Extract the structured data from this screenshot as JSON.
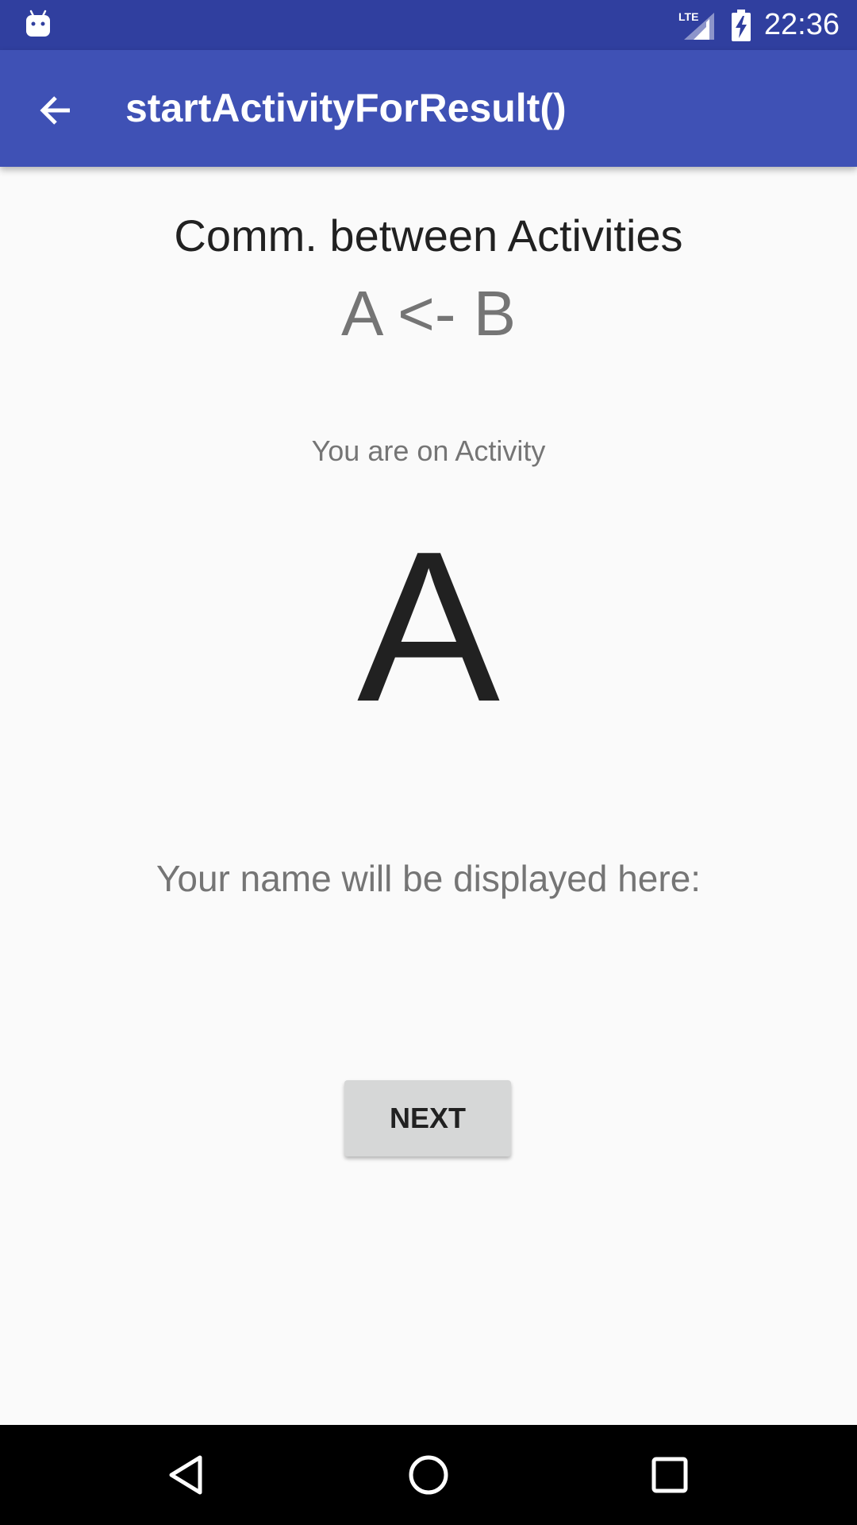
{
  "status_bar": {
    "time": "22:36",
    "network_label": "LTE",
    "icons": [
      "android-icon",
      "lte-signal-icon",
      "battery-charging-icon"
    ]
  },
  "app_bar": {
    "title": "startActivityForResult()",
    "back_icon": "arrow-back-icon",
    "color": "#3f51b5"
  },
  "main": {
    "heading": "Comm. between Activities",
    "subheading": "A <- B",
    "location_label": "You are on Activity",
    "activity_letter": "A",
    "name_placeholder": "Your name will be displayed here:",
    "next_button_label": "NEXT"
  },
  "nav_bar": {
    "icons": [
      "nav-back-icon",
      "nav-home-icon",
      "nav-recents-icon"
    ]
  },
  "colors": {
    "status_bar": "#303f9f",
    "primary": "#3f51b5",
    "background": "#fafafa",
    "button": "#d6d7d7"
  }
}
